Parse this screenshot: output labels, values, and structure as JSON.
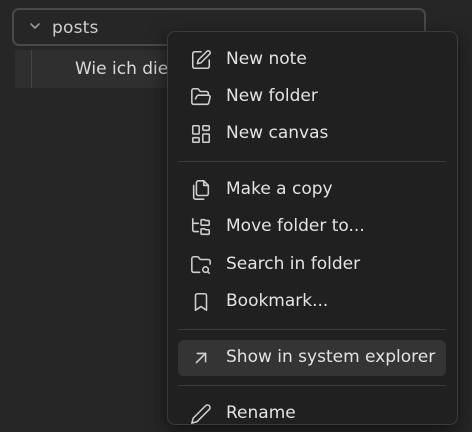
{
  "file_tree": {
    "folder": {
      "name": "posts",
      "expanded": true,
      "icon": "chevron-down-icon"
    },
    "child": {
      "name": "Wie ich die"
    }
  },
  "context_menu": {
    "items": [
      {
        "label": "New note",
        "icon": "edit-icon"
      },
      {
        "label": "New folder",
        "icon": "folder-open-icon"
      },
      {
        "label": "New canvas",
        "icon": "layout-dashboard-icon"
      },
      {
        "label": "Make a copy",
        "icon": "copy-icon"
      },
      {
        "label": "Move folder to...",
        "icon": "folder-tree-icon"
      },
      {
        "label": "Search in folder",
        "icon": "folder-search-icon"
      },
      {
        "label": "Bookmark...",
        "icon": "bookmark-icon"
      },
      {
        "label": "Show in system explorer",
        "icon": "arrow-up-right-icon",
        "highlighted": true
      },
      {
        "label": "Rename",
        "icon": "pencil-icon"
      }
    ]
  }
}
